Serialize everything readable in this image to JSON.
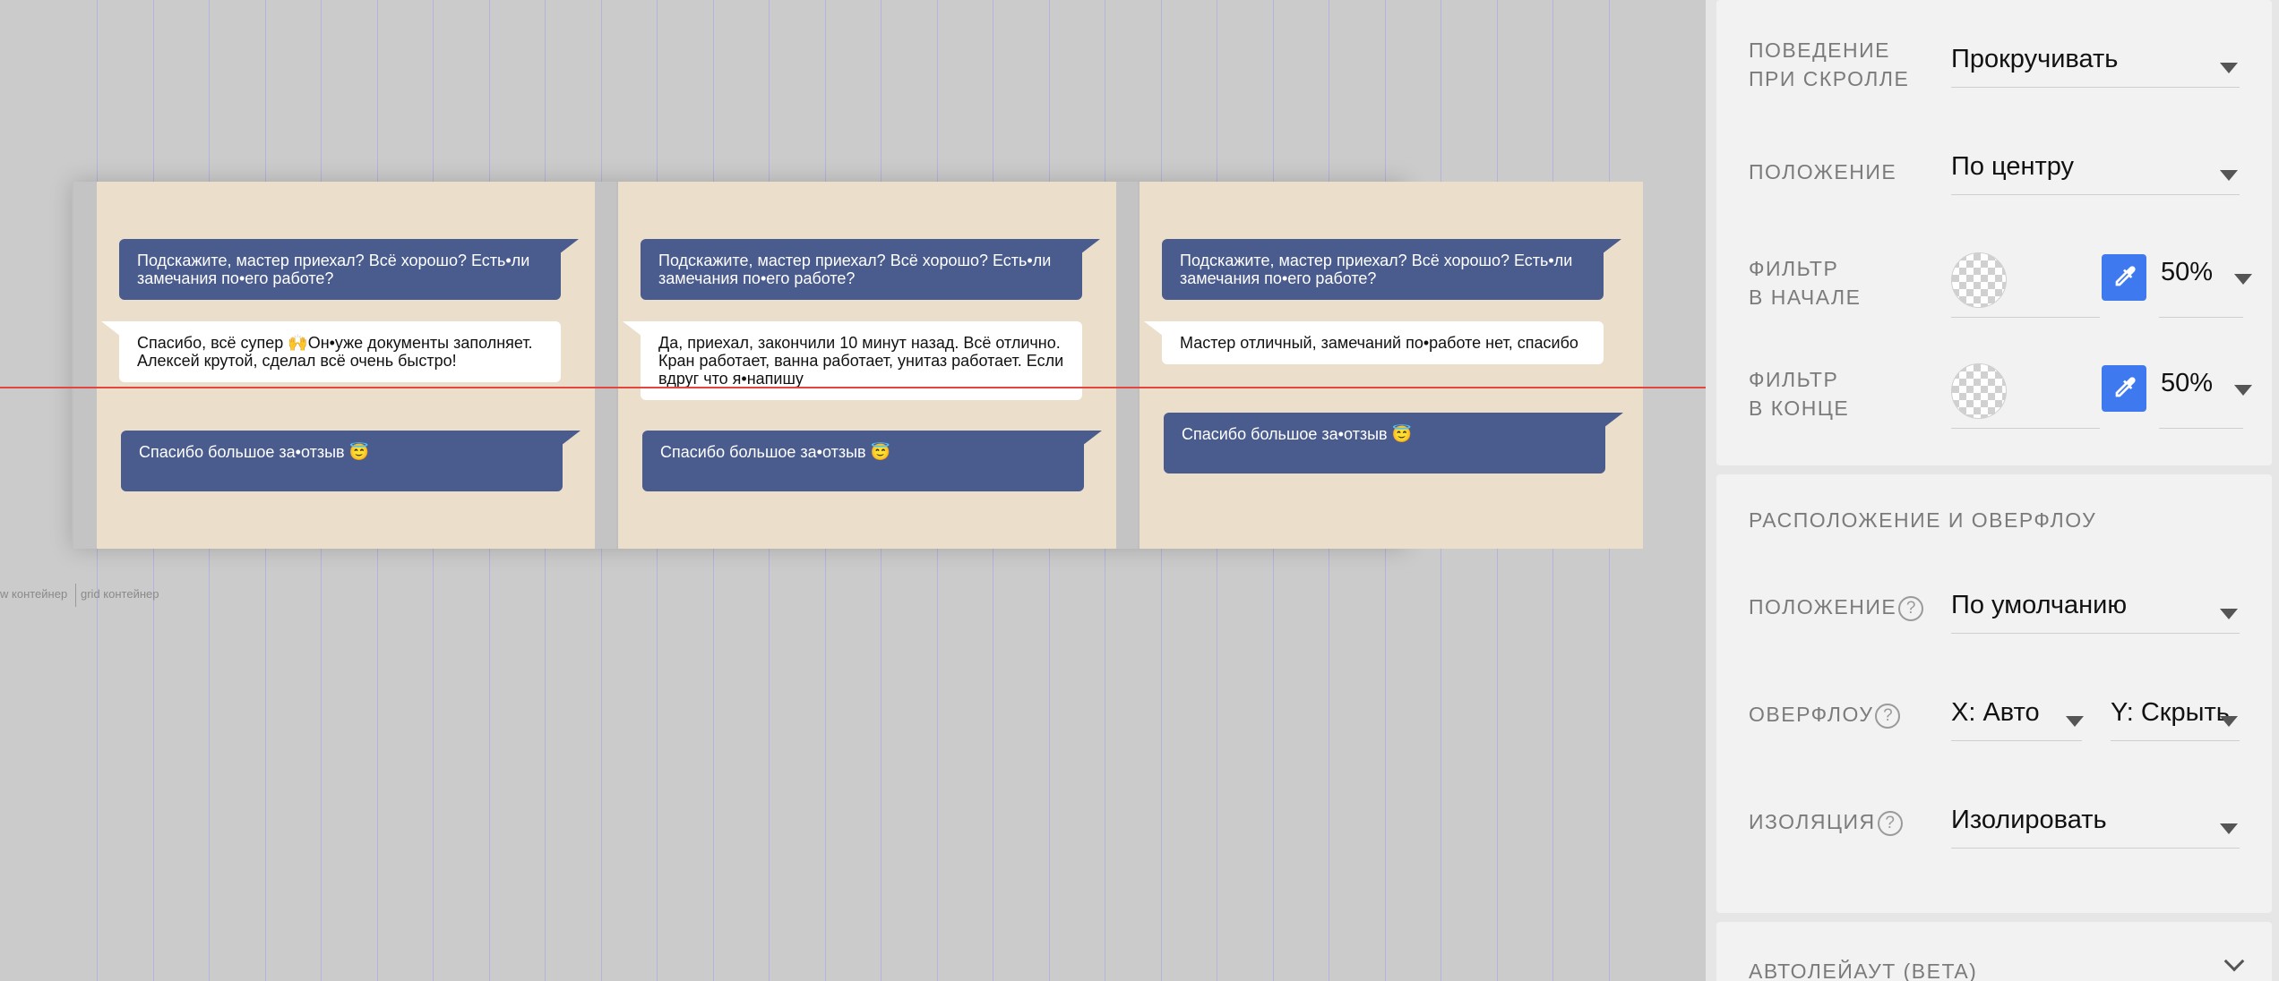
{
  "canvas": {
    "cards": [
      {
        "q": "Подскажите, мастер приехал? Всё хорошо? Есть•ли замечания по•его работе?",
        "a": "Спасибо, всё супер 🙌Он•уже документы заполняет. Алексей крутой, сделал всё очень быстро!",
        "thanks": "Спасибо большое за•отзыв 😇"
      },
      {
        "q": "Подскажите, мастер приехал? Всё хорошо? Есть•ли замечания по•его работе?",
        "a": "Да, приехал, закончили 10 минут назад. Всё отлично. Кран работает, ванна работает, унитаз работает. Если вдруг что я•напишу",
        "thanks": "Спасибо большое за•отзыв 😇"
      },
      {
        "q": "Подскажите, мастер приехал? Всё хорошо? Есть•ли замечания по•его работе?",
        "a": "Мастер отличный, замечаний по•работе нет, спасибо",
        "thanks": "Спасибо большое за•отзыв 😇"
      }
    ],
    "captions": {
      "flex": "w контейнер",
      "grid": "grid контейнер"
    }
  },
  "panel": {
    "scroll": {
      "label_line1": "ПОВЕДЕНИЕ",
      "label_line2": "ПРИ СКРОЛЛЕ",
      "value": "Прокручивать"
    },
    "position_bg": {
      "label": "ПОЛОЖЕНИЕ",
      "value": "По центру"
    },
    "filter_start": {
      "label_line1": "ФИЛЬТР",
      "label_line2": "В НАЧАЛЕ",
      "value": "50%"
    },
    "filter_end": {
      "label_line1": "ФИЛЬТР",
      "label_line2": "В КОНЦЕ",
      "value": "50%"
    },
    "layout": {
      "title": "РАСПОЛОЖЕНИЕ И ОВЕРФЛОУ",
      "position": {
        "label": "ПОЛОЖЕНИЕ",
        "value": "По умолчанию"
      },
      "overflow": {
        "label": "ОВЕРФЛОУ",
        "x_value": "X: Авто",
        "y_value": "Y: Скрыть"
      },
      "isolation": {
        "label": "ИЗОЛЯЦИЯ",
        "value": "Изолировать"
      },
      "help_glyph": "?"
    },
    "autolayout": {
      "title": "АВТОЛЕЙАУТ (BETA)"
    }
  },
  "colors": {
    "card_bg": "#ebdfcc",
    "bubble_out": "#4a5b8d",
    "bubble_in": "#ffffff",
    "guide_red": "#e3463f",
    "picker_blue": "#3e79f0"
  },
  "icons": [
    "eyedropper-icon",
    "help-icon",
    "caret-down-icon",
    "chevron-down-icon",
    "transparent-swatch-icon"
  ]
}
